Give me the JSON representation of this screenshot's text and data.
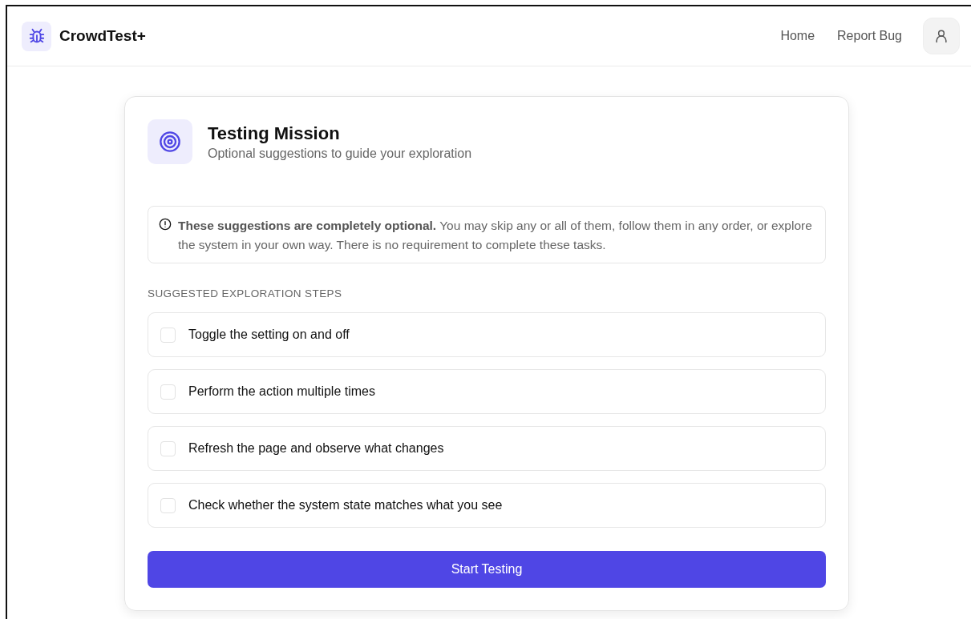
{
  "header": {
    "brand": "CrowdTest+",
    "nav": [
      "Home",
      "Report Bug"
    ]
  },
  "mission": {
    "title": "Testing Mission",
    "subtitle": "Optional suggestions to guide your exploration",
    "notice": "**These suggestions are completely optional.** You may skip any or all of them, follow them in any order, or explore the system in your own way. There is no requirement to complete these tasks.",
    "steps_heading": "SUGGESTED EXPLORATION STEPS",
    "steps": [
      {
        "label": "Toggle the setting on and off",
        "checked": false
      },
      {
        "label": "Perform the action multiple times",
        "checked": false
      },
      {
        "label": "Refresh the page and observe what changes",
        "checked": false
      },
      {
        "label": "Check whether the system state matches what you see",
        "checked": false
      }
    ],
    "button": "Start Testing"
  }
}
